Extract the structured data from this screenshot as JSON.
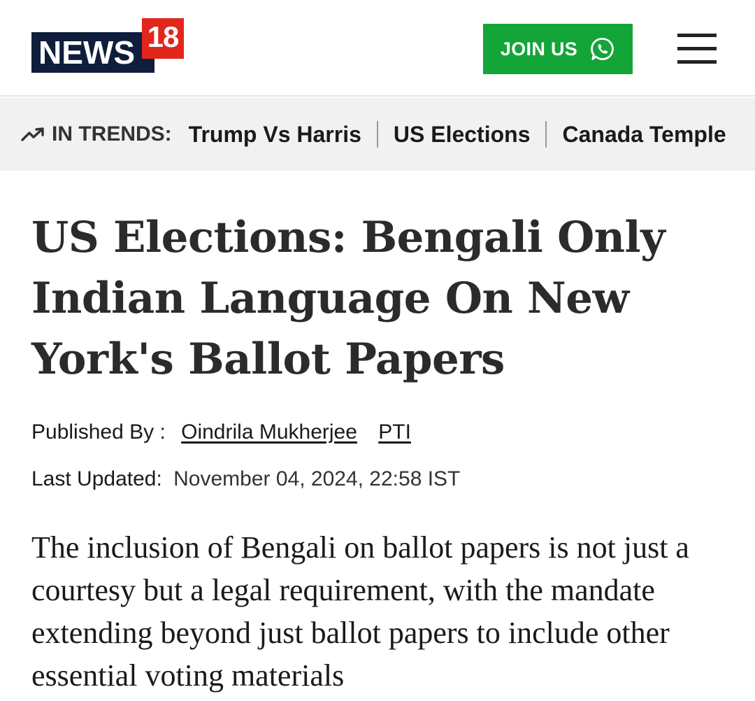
{
  "header": {
    "logo": {
      "text_main": "NEWS",
      "text_number": "18",
      "colors": {
        "navy": "#0f1e3c",
        "red": "#e1261c"
      }
    },
    "join_button": {
      "label": "JOIN US",
      "icon": "whatsapp-icon",
      "color": "#13a538"
    },
    "menu_icon": "hamburger-menu-icon"
  },
  "trends": {
    "icon": "trending-up-icon",
    "label": "IN TRENDS:",
    "items": [
      {
        "label": "Trump Vs Harris"
      },
      {
        "label": "US Elections"
      },
      {
        "label": "Canada Temple"
      }
    ]
  },
  "article": {
    "headline": "US Elections: Bengali Only Indian Language On New York's Ballot Papers",
    "published_by_label": "Published By :",
    "authors": [
      "Oindrila Mukherjee",
      "PTI"
    ],
    "last_updated_label": "Last Updated:",
    "last_updated_value": "November 04, 2024, 22:58 IST",
    "summary": "The inclusion of Bengali on ballot papers is not just a courtesy but a legal requirement, with the mandate extending beyond just ballot papers to include other essential voting materials"
  }
}
